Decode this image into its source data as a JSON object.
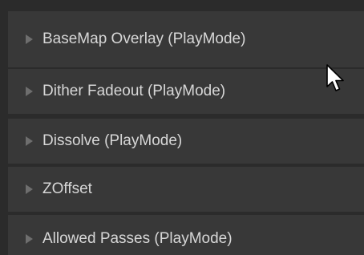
{
  "sections": [
    {
      "label": "BaseMap Overlay (PlayMode)",
      "icon": "chevron-right-icon"
    },
    {
      "label": "Dither Fadeout (PlayMode)",
      "icon": "chevron-right-icon"
    },
    {
      "label": "Dissolve (PlayMode)",
      "icon": "chevron-right-icon"
    },
    {
      "label": "ZOffset",
      "icon": "chevron-right-icon"
    },
    {
      "label": "Allowed Passes (PlayMode)",
      "icon": "chevron-right-icon"
    }
  ],
  "cursor": {
    "icon": "mouse-pointer-icon"
  },
  "colors": {
    "background": "#2b2b2b",
    "section": "#383838",
    "text": "#d7d7d7",
    "caret": "#6e6e6e"
  }
}
